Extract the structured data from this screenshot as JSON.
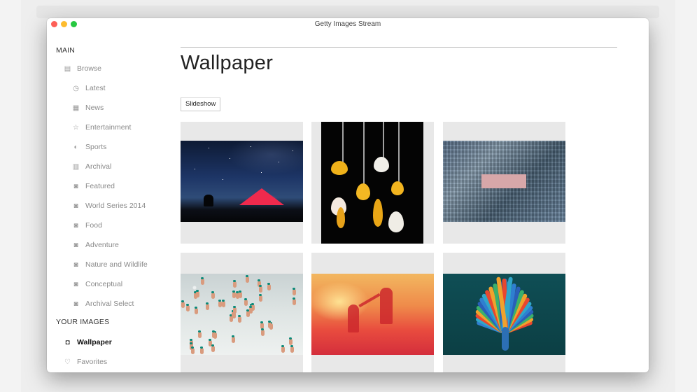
{
  "window": {
    "title": "Getty Images Stream"
  },
  "sidebar": {
    "main_heading": "MAIN",
    "items": [
      {
        "label": "Browse",
        "icon": "browse-icon"
      },
      {
        "label": "Latest",
        "icon": "clock-icon"
      },
      {
        "label": "News",
        "icon": "newspaper-icon"
      },
      {
        "label": "Entertainment",
        "icon": "star-icon"
      },
      {
        "label": "Sports",
        "icon": "sports-icon"
      },
      {
        "label": "Archival",
        "icon": "archive-icon"
      },
      {
        "label": "Featured",
        "icon": "camera-icon"
      },
      {
        "label": "World Series 2014",
        "icon": "camera-icon"
      },
      {
        "label": "Food",
        "icon": "camera-icon"
      },
      {
        "label": "Adventure",
        "icon": "camera-icon"
      },
      {
        "label": "Nature and Wildlife",
        "icon": "camera-icon"
      },
      {
        "label": "Conceptual",
        "icon": "camera-icon"
      },
      {
        "label": "Archival Select",
        "icon": "camera-icon"
      }
    ],
    "your_images_heading": "YOUR IMAGES",
    "your_items": [
      {
        "label": "Wallpaper",
        "icon": "wallpaper-icon",
        "active": true
      },
      {
        "label": "Favorites",
        "icon": "heart-icon"
      }
    ]
  },
  "main": {
    "title": "Wallpaper",
    "slideshow_label": "Slideshow"
  },
  "colors": {
    "traffic_red": "#fd5f57",
    "traffic_yellow": "#fdbc2e",
    "traffic_green": "#27c840",
    "tile_bg": "#e8e8e8"
  }
}
